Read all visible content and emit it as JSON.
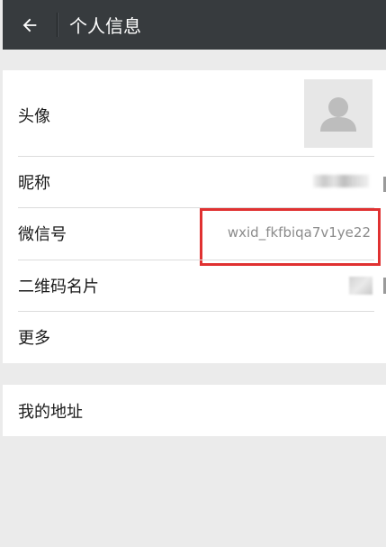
{
  "header": {
    "title": "个人信息",
    "back_icon": "arrow-left-icon"
  },
  "profile": {
    "avatar_label": "头像",
    "nickname_label": "昵称",
    "wechat_id_label": "微信号",
    "wechat_id_value": "wxid_fkfbiqa7v1ye22",
    "qr_code_label": "二维码名片",
    "more_label": "更多"
  },
  "address": {
    "label": "我的地址"
  },
  "colors": {
    "titlebar": "#373b3e",
    "highlight": "#e03131",
    "background": "#ebebeb"
  }
}
